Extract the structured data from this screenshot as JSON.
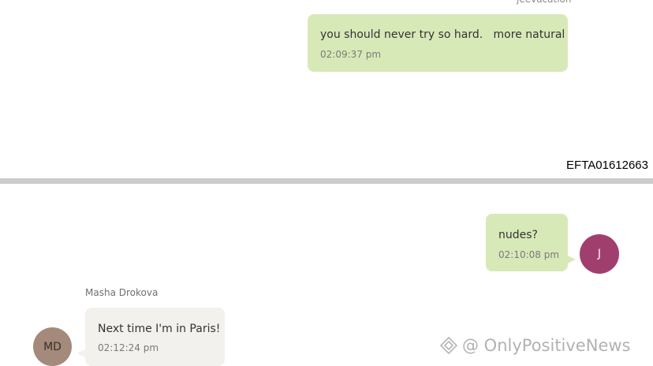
{
  "top_section": {
    "sender_name": "jeevacation",
    "message": {
      "text": "you should never try so hard.   more natural",
      "time": "02:09:37 pm"
    }
  },
  "document_id": "EFTA01612663",
  "bottom_section": {
    "sent_message": {
      "text": "nudes?",
      "time": "02:10:08 pm",
      "avatar_initial": "J"
    },
    "received_message": {
      "sender_name": "Masha Drokova",
      "text": "Next time I'm in Paris!",
      "time": "02:12:24 pm",
      "avatar_initials": "MD"
    }
  },
  "watermark": {
    "text": "@ OnlyPositiveNews",
    "icon": "diamond-logo-icon"
  },
  "colors": {
    "sent_bubble": "#d8e9b8",
    "received_bubble": "#f3f1ee",
    "avatar_j": "#a03f6e",
    "avatar_md": "#a38a7a",
    "divider": "#cccccc"
  }
}
